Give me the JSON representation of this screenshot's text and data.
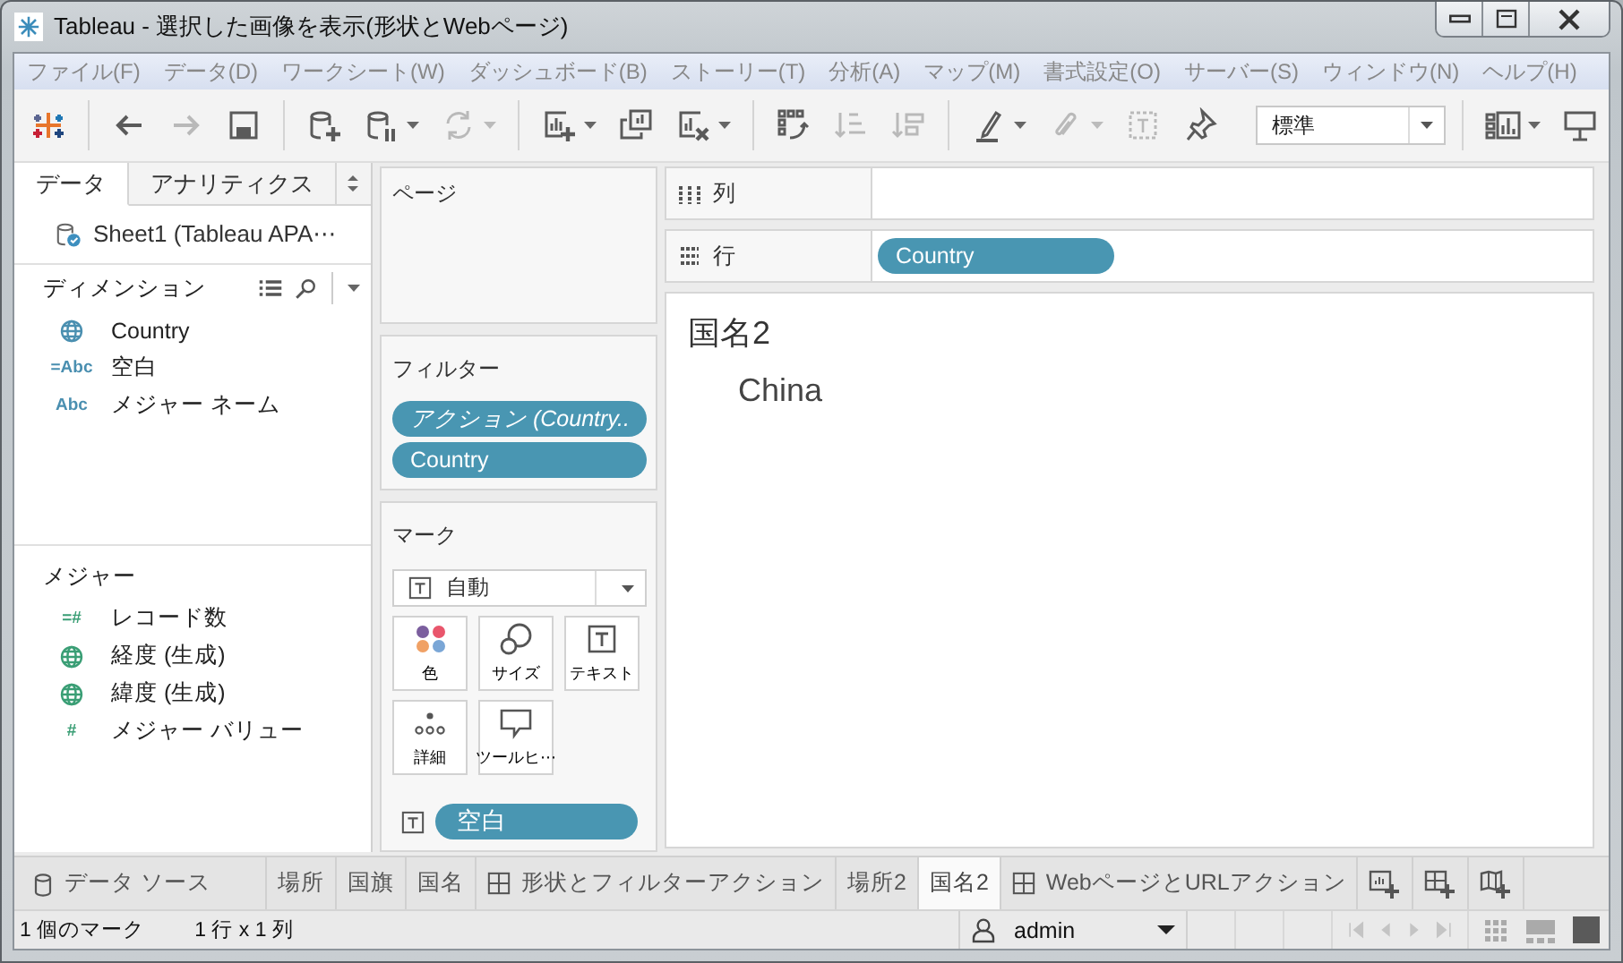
{
  "window": {
    "title": "Tableau - 選択した画像を表示(形状とWebページ)"
  },
  "menu": [
    "ファイル(F)",
    "データ(D)",
    "ワークシート(W)",
    "ダッシュボード(B)",
    "ストーリー(T)",
    "分析(A)",
    "マップ(M)",
    "書式設定(O)",
    "サーバー(S)",
    "ウィンドウ(N)",
    "ヘルプ(H)"
  ],
  "toolbar": [
    [
      {
        "kind": "logo"
      }
    ],
    [
      {
        "kind": "back",
        "disabled": false
      },
      {
        "kind": "forward",
        "disabled": true
      },
      {
        "kind": "save",
        "disabled": false
      }
    ],
    [
      {
        "kind": "new-datasource",
        "disabled": false
      },
      {
        "kind": "pause",
        "disabled": false,
        "has_menu": true
      },
      {
        "kind": "refresh",
        "disabled": true,
        "has_menu": true
      }
    ],
    [
      {
        "kind": "new-sheet",
        "disabled": false,
        "has_menu": true
      },
      {
        "kind": "duplicate",
        "disabled": false
      },
      {
        "kind": "clear",
        "disabled": false,
        "has_menu": true
      }
    ],
    [
      {
        "kind": "swap",
        "disabled": false
      },
      {
        "kind": "sort-asc",
        "disabled": true
      },
      {
        "kind": "sort-desc",
        "disabled": true
      }
    ],
    [
      {
        "kind": "highlight",
        "disabled": false,
        "has_menu": true
      },
      {
        "kind": "group",
        "disabled": true,
        "has_menu": true
      },
      {
        "kind": "label",
        "disabled": true
      },
      {
        "kind": "pin",
        "disabled": false
      },
      {
        "kind": "select",
        "value": "標準"
      }
    ],
    [
      {
        "kind": "show-me",
        "disabled": false,
        "has_menu": true
      },
      {
        "kind": "presentation",
        "disabled": false
      }
    ]
  ],
  "data_pane": {
    "tabs": [
      {
        "label": "データ",
        "selected": true
      },
      {
        "label": "アナリティクス",
        "selected": false
      }
    ],
    "datasource": "Sheet1 (Tableau APA⋯",
    "dimensions": {
      "title": "ディメンション",
      "fields": [
        {
          "kind": "geo",
          "name": "Country"
        },
        {
          "kind": "type",
          "type_label": "=Abc",
          "name": "空白"
        },
        {
          "kind": "type",
          "type_label": "Abc",
          "name": "メジャー ネーム"
        }
      ]
    },
    "measures": {
      "title": "メジャー",
      "fields": [
        {
          "kind": "type",
          "type_label": "=#",
          "name": "レコード数"
        },
        {
          "kind": "geo",
          "name": "経度 (生成)"
        },
        {
          "kind": "geo",
          "name": "緯度 (生成)"
        },
        {
          "kind": "type",
          "type_label": "#",
          "name": "メジャー バリュー"
        }
      ]
    }
  },
  "pages": {
    "title": "ページ"
  },
  "filters": {
    "title": "フィルター",
    "pills": [
      {
        "kind": "action",
        "label": "アクション (Country.."
      },
      {
        "kind": "field",
        "label": "Country"
      }
    ]
  },
  "marks": {
    "title": "マーク",
    "type": "自動",
    "buttons": [
      {
        "kind": "color",
        "label": "色"
      },
      {
        "kind": "size",
        "label": "サイズ"
      },
      {
        "kind": "text",
        "label": "テキスト"
      },
      {
        "kind": "detail",
        "label": "詳細"
      },
      {
        "kind": "tooltip",
        "label": "ツールヒ⋯"
      }
    ],
    "pills": [
      {
        "kind": "text",
        "label": "空白"
      }
    ]
  },
  "columns": {
    "label": "列"
  },
  "rows": {
    "label": "行",
    "pills": [
      "Country"
    ]
  },
  "view": {
    "title": "国名2",
    "value": "China"
  },
  "sheet_tabs": [
    {
      "kind": "datasource",
      "label": "データ ソース",
      "selected": false
    },
    {
      "kind": "sheet",
      "label": "場所",
      "selected": false
    },
    {
      "kind": "sheet",
      "label": "国旗",
      "selected": false
    },
    {
      "kind": "sheet",
      "label": "国名",
      "selected": false
    },
    {
      "kind": "dashboard",
      "label": "形状とフィルターアクション",
      "selected": false
    },
    {
      "kind": "sheet",
      "label": "場所2",
      "selected": false
    },
    {
      "kind": "sheet",
      "label": "国名2",
      "selected": true
    },
    {
      "kind": "dashboard",
      "label": "WebページとURLアクション",
      "selected": false
    }
  ],
  "status_bar": {
    "marks": "1 個のマーク",
    "size": "1 行 x 1 列",
    "user": "admin"
  }
}
